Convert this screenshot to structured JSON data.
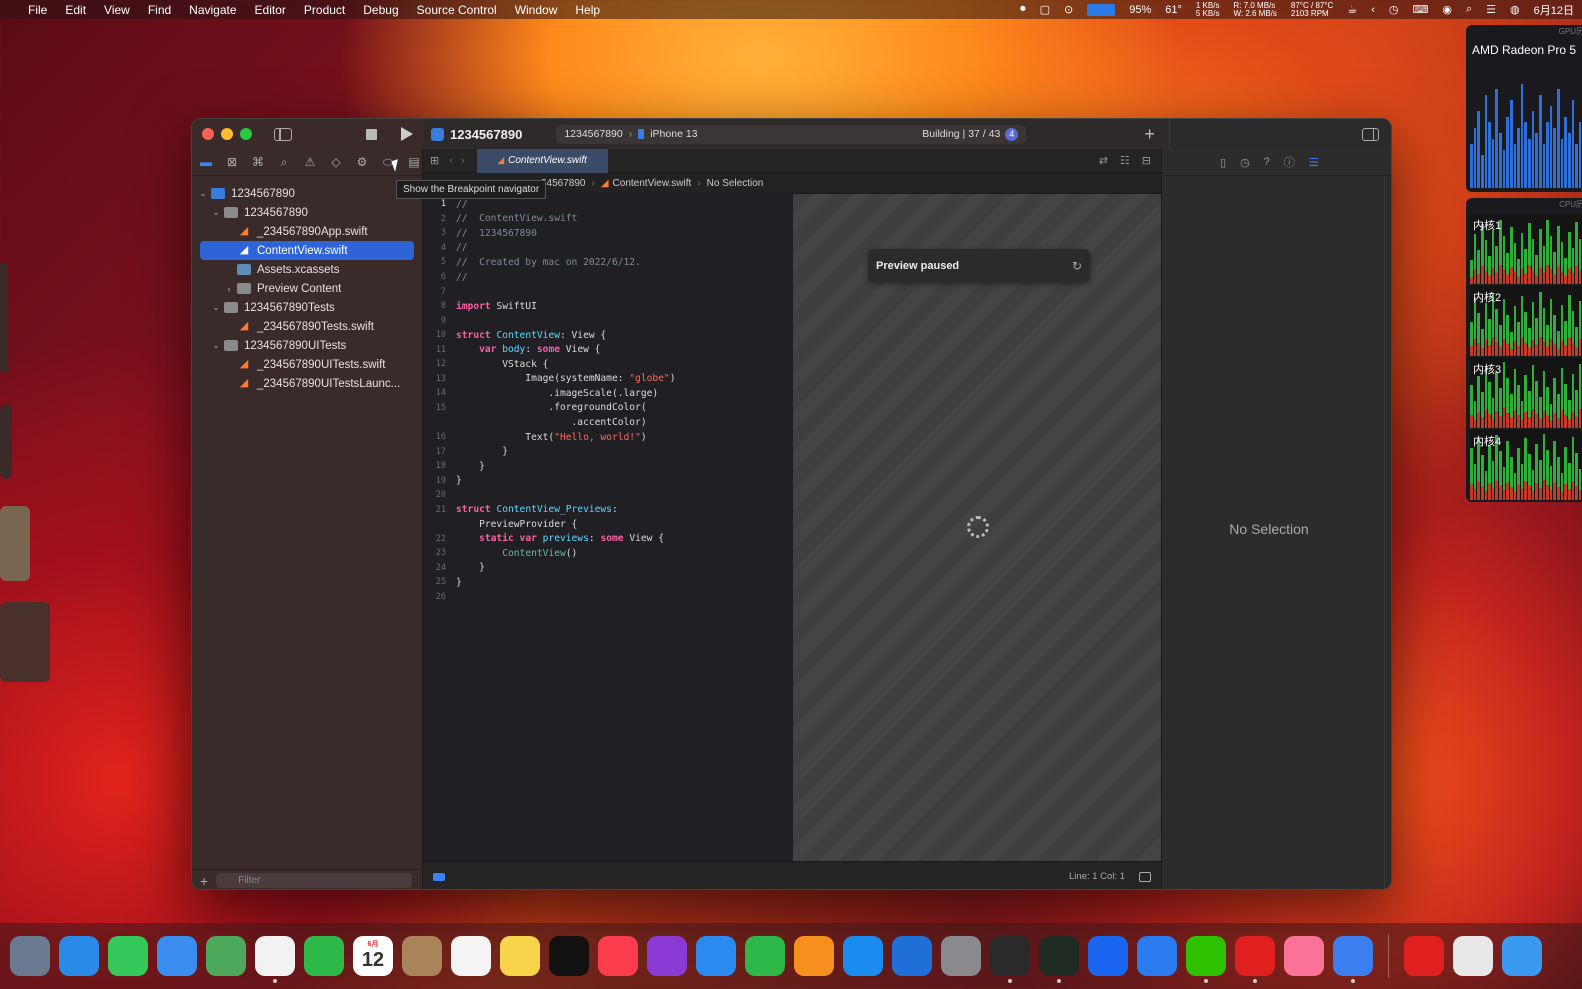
{
  "menubar": {
    "app_icon": "apple-icon",
    "menus": [
      "File",
      "Edit",
      "View",
      "Find",
      "Navigate",
      "Editor",
      "Product",
      "Debug",
      "Source Control",
      "Window",
      "Help"
    ],
    "status": {
      "battery_percent": "95%",
      "temp": "61°",
      "net_up": "1 KB/s",
      "net_down": "5 KB/s",
      "disk_r_label": "R:",
      "disk_w_label": "W:",
      "disk_r": "7.0 MB/s",
      "disk_w": "2.6 MB/s",
      "cpu_temp": "87°C / 87°C",
      "fan": "2103 RPM",
      "date": "6月12日"
    }
  },
  "xcode": {
    "project_name": "1234567890",
    "scheme_target": "1234567890",
    "device": "iPhone 13",
    "build_status": "Building | 37 / 43",
    "build_badge": "4",
    "navigator": {
      "tooltip": "Show the Breakpoint navigator",
      "tree": [
        {
          "label": "1234567890",
          "icon": "project",
          "indent": 0,
          "disclosure": "open"
        },
        {
          "label": "1234567890",
          "icon": "folder",
          "indent": 1,
          "disclosure": "open"
        },
        {
          "label": "_234567890App.swift",
          "icon": "swift",
          "indent": 2,
          "disclosure": ""
        },
        {
          "label": "ContentView.swift",
          "icon": "swift",
          "indent": 2,
          "disclosure": "",
          "selected": true
        },
        {
          "label": "Assets.xcassets",
          "icon": "assets",
          "indent": 2,
          "disclosure": ""
        },
        {
          "label": "Preview Content",
          "icon": "folder",
          "indent": 2,
          "disclosure": "closed"
        },
        {
          "label": "1234567890Tests",
          "icon": "folder",
          "indent": 1,
          "disclosure": "open"
        },
        {
          "label": "_234567890Tests.swift",
          "icon": "swift",
          "indent": 2,
          "disclosure": ""
        },
        {
          "label": "1234567890UITests",
          "icon": "folder",
          "indent": 1,
          "disclosure": "open"
        },
        {
          "label": "_234567890UITests.swift",
          "icon": "swift",
          "indent": 2,
          "disclosure": ""
        },
        {
          "label": "_234567890UITestsLaunc...",
          "icon": "swift",
          "indent": 2,
          "disclosure": ""
        }
      ],
      "filter_placeholder": "Filter"
    },
    "editor": {
      "active_tab": "ContentView.swift",
      "jumpbar": {
        "project": "34567890",
        "file": "ContentView.swift",
        "symbol": "No Selection"
      },
      "code_lines": [
        {
          "n": "1",
          "html": "<span class='cm'>//</span>"
        },
        {
          "n": "2",
          "html": "<span class='cm'>//  ContentView.swift</span>"
        },
        {
          "n": "3",
          "html": "<span class='cm'>//  1234567890</span>"
        },
        {
          "n": "4",
          "html": "<span class='cm'>//</span>"
        },
        {
          "n": "5",
          "html": "<span class='cm'>//  Created by mac on 2022/6/12.</span>"
        },
        {
          "n": "6",
          "html": "<span class='cm'>//</span>"
        },
        {
          "n": "7",
          "html": ""
        },
        {
          "n": "8",
          "html": "<span class='kw'>import</span> SwiftUI"
        },
        {
          "n": "9",
          "html": ""
        },
        {
          "n": "10",
          "html": "<span class='kw'>struct</span> <span class='ty'>ContentView</span>: View {"
        },
        {
          "n": "11",
          "html": "    <span class='kw'>var</span> <span class='ty'>body</span>: <span class='kw'>some</span> View {"
        },
        {
          "n": "12",
          "html": "        VStack {"
        },
        {
          "n": "13",
          "html": "            Image(systemName: <span class='st'>\"globe\"</span>)"
        },
        {
          "n": "14",
          "html": "                .imageScale(.large)"
        },
        {
          "n": "15",
          "html": "                .foregroundColor("
        },
        {
          "n": "",
          "html": "                    .accentColor)"
        },
        {
          "n": "16",
          "html": "            Text(<span class='st'>\"Hello, world!\"</span>)"
        },
        {
          "n": "17",
          "html": "        }"
        },
        {
          "n": "18",
          "html": "    }"
        },
        {
          "n": "19",
          "html": "}"
        },
        {
          "n": "20",
          "html": ""
        },
        {
          "n": "21",
          "html": "<span class='kw'>struct</span> <span class='ty'>ContentView_Previews</span>:"
        },
        {
          "n": "",
          "html": "    PreviewProvider {"
        },
        {
          "n": "22",
          "html": "    <span class='kw'>static</span> <span class='kw'>var</span> <span class='ty'>previews</span>: <span class='kw'>some</span> View {"
        },
        {
          "n": "23",
          "html": "        <span class='fn'>ContentView</span>()"
        },
        {
          "n": "24",
          "html": "    }"
        },
        {
          "n": "25",
          "html": "}"
        },
        {
          "n": "26",
          "html": ""
        }
      ],
      "footer_position": "Line: 1  Col: 1"
    },
    "preview": {
      "status": "Preview paused"
    },
    "inspector": {
      "empty_text": "No Selection"
    }
  },
  "widgets": {
    "gpu_title": "AMD Radeon Pro 5",
    "gpu_header": "GPU历史",
    "cpu_header": "CPU历史",
    "cores": [
      "内核1",
      "内核2",
      "内核3",
      "内核4"
    ]
  },
  "dock": {
    "calendar_month": "6月",
    "calendar_day": "12",
    "apps": [
      "launchpad-icon",
      "safari-icon",
      "messages-icon",
      "mail-icon",
      "maps-icon",
      "photos-icon",
      "facetime-icon",
      "calendar-icon",
      "contacts-icon",
      "reminders-icon",
      "notes-icon",
      "appletv-icon",
      "music-icon",
      "podcasts-icon",
      "keynote-icon",
      "numbers-icon",
      "pages-icon",
      "appstore-icon",
      "xcode-icon",
      "settings-icon",
      "terminal-icon",
      "activity-monitor-icon",
      "lark-icon",
      "feishu-icon",
      "wechat-icon",
      "netease-music-icon",
      "bilibili-icon",
      "xcode-beta-icon"
    ]
  },
  "colors": {
    "accent": "#2f64d6",
    "swift_orange": "#ff7a2e",
    "keyword_pink": "#fc5fa3"
  }
}
